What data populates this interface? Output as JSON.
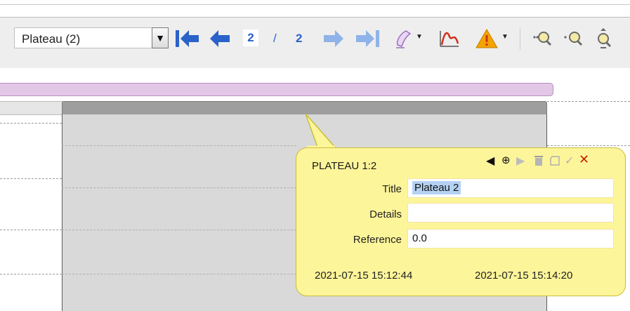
{
  "toolbar": {
    "dropdown_value": "Plateau (2)",
    "dropdown_arrow": "▼",
    "page_current": "2",
    "page_separator": "/",
    "page_total": "2",
    "icons": [
      "first-page-icon",
      "previous-icon",
      "next-icon",
      "last-page-icon",
      "marker-icon",
      "curve-fit-icon",
      "warning-icon",
      "zoom-in-icon",
      "zoom-out-icon",
      "zoom-fit-icon"
    ],
    "colors": {
      "nav_blue": "#2a62c9",
      "nav_disabled": "#8fb3e8",
      "warning": "#f2a400",
      "curve_red": "#d2301c"
    }
  },
  "annotation": {
    "header": "PLATEAU 1:2",
    "controls": [
      "prev-icon",
      "target-icon",
      "next-icon",
      "trash-icon",
      "copy-icon",
      "check-icon",
      "close-icon"
    ],
    "fields": [
      {
        "label": "Title",
        "value": "Plateau 2"
      },
      {
        "label": "Details",
        "value": ""
      },
      {
        "label": "Reference",
        "value": "0.0"
      }
    ],
    "start_time": "2021-07-15 15:12:44",
    "end_time": "2021-07-15 15:14:20",
    "colors": {
      "bubble": "#fdf59a",
      "border": "#c9bd3a",
      "close": "#c82000"
    }
  }
}
